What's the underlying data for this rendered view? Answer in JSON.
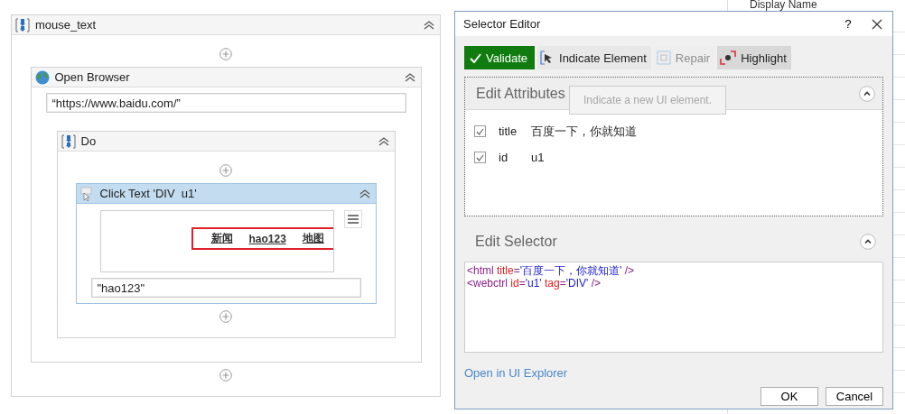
{
  "workflow": {
    "title": "mouse_text",
    "kind": "sequence",
    "expanded": true,
    "children": [
      {
        "title": "Open Browser",
        "kind": "browser",
        "expanded": true,
        "url": "“https://www.baidu.com/”",
        "children": [
          {
            "title": "Do",
            "kind": "sequence",
            "expanded": true,
            "children": [
              {
                "title": "Click Text 'DIV  u1'",
                "kind": "click_text",
                "expanded": true,
                "selected": true,
                "preview_links": [
                  "新闻",
                  "hao123",
                  "地图"
                ],
                "text": "\"hao123\""
              }
            ]
          }
        ]
      }
    ]
  },
  "properties_panel": {
    "label": "Display Name"
  },
  "dialog": {
    "title": "Selector Editor",
    "help": "?",
    "toolbar": [
      {
        "label": "Validate",
        "kind": "validate",
        "disabled": false,
        "on": false
      },
      {
        "label": "Indicate Element",
        "kind": "indicate",
        "disabled": false,
        "on": false
      },
      {
        "label": "Repair",
        "kind": "repair",
        "disabled": true,
        "on": false
      },
      {
        "label": "Highlight",
        "kind": "highlight",
        "disabled": false,
        "on": true
      }
    ],
    "attributes_panel": {
      "title": "Edit Attributes",
      "expanded": true,
      "rows": [
        {
          "name": "title",
          "value": "百度一下，你就知道",
          "checked": true
        },
        {
          "name": "id",
          "value": "u1",
          "checked": true
        }
      ]
    },
    "tooltip": "Indicate a new UI element.",
    "selector_panel": {
      "title": "Edit Selector",
      "expanded": true,
      "lines": [
        [
          {
            "kind": "tag",
            "text": "<html"
          },
          {
            "kind": "attr",
            "text": " title"
          },
          {
            "kind": "punct",
            "text": "="
          },
          {
            "kind": "value",
            "text": "'百度一下，你就知道'"
          },
          {
            "kind": "tag",
            "text": " />"
          }
        ],
        [
          {
            "kind": "tag",
            "text": "<webctrl"
          },
          {
            "kind": "attr",
            "text": " id"
          },
          {
            "kind": "punct",
            "text": "="
          },
          {
            "kind": "value",
            "text": "'u1'"
          },
          {
            "kind": "attr",
            "text": " tag"
          },
          {
            "kind": "punct",
            "text": "="
          },
          {
            "kind": "value",
            "text": "'DIV'"
          },
          {
            "kind": "tag",
            "text": " />"
          }
        ]
      ]
    },
    "link": "Open in UI Explorer",
    "buttons": [
      "OK",
      "Cancel"
    ]
  }
}
